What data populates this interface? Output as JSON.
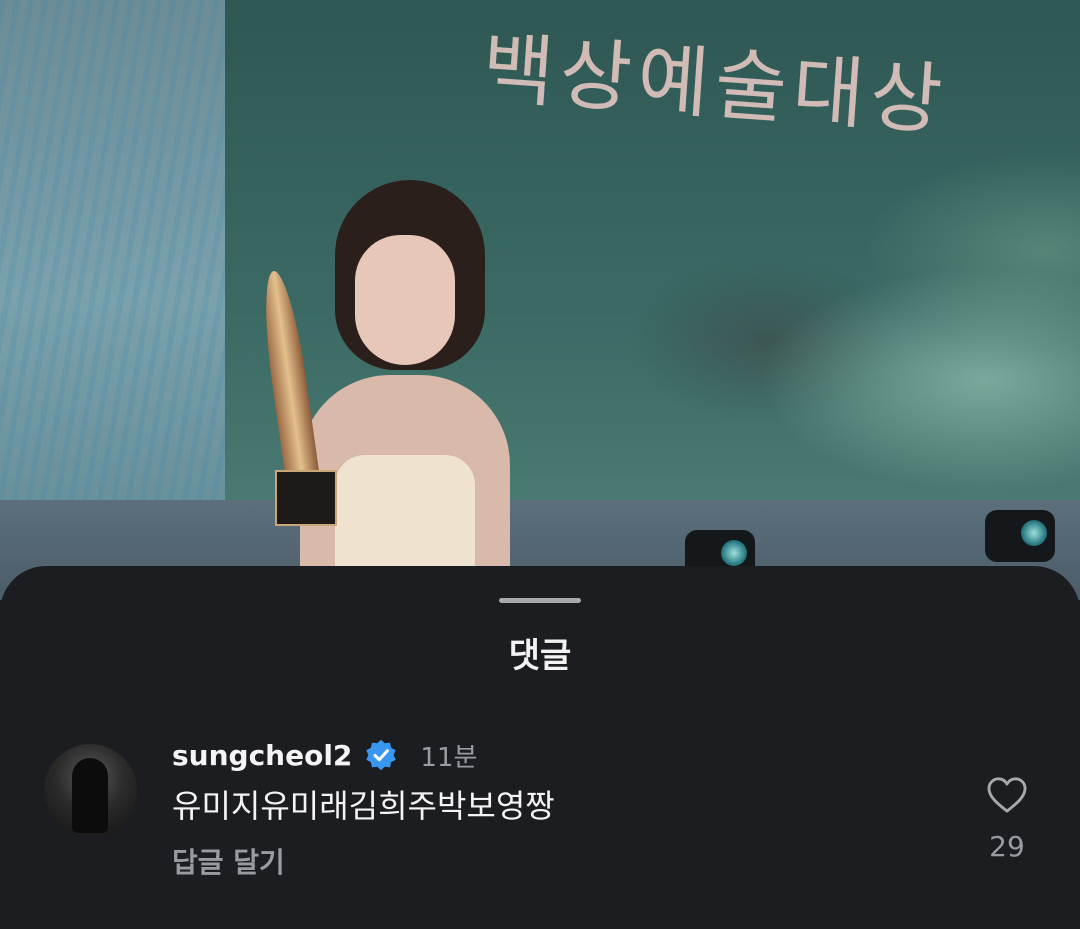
{
  "photo": {
    "banner_text": "백상예술대상",
    "subject": "photo"
  },
  "sheet": {
    "title": "댓글"
  },
  "comment": {
    "username": "sungcheol2",
    "verified_icon": "verified-badge-icon",
    "time": "11분",
    "text": "유미지유미래김희주박보영짱",
    "reply_label": "답글 달기",
    "like_icon": "heart-outline-icon",
    "like_count": "29"
  },
  "colors": {
    "sheet_background": "#1c1d21",
    "verified_blue": "#3897f0",
    "muted_text": "#9a9ba0",
    "primary_text": "#f4f4f4"
  }
}
